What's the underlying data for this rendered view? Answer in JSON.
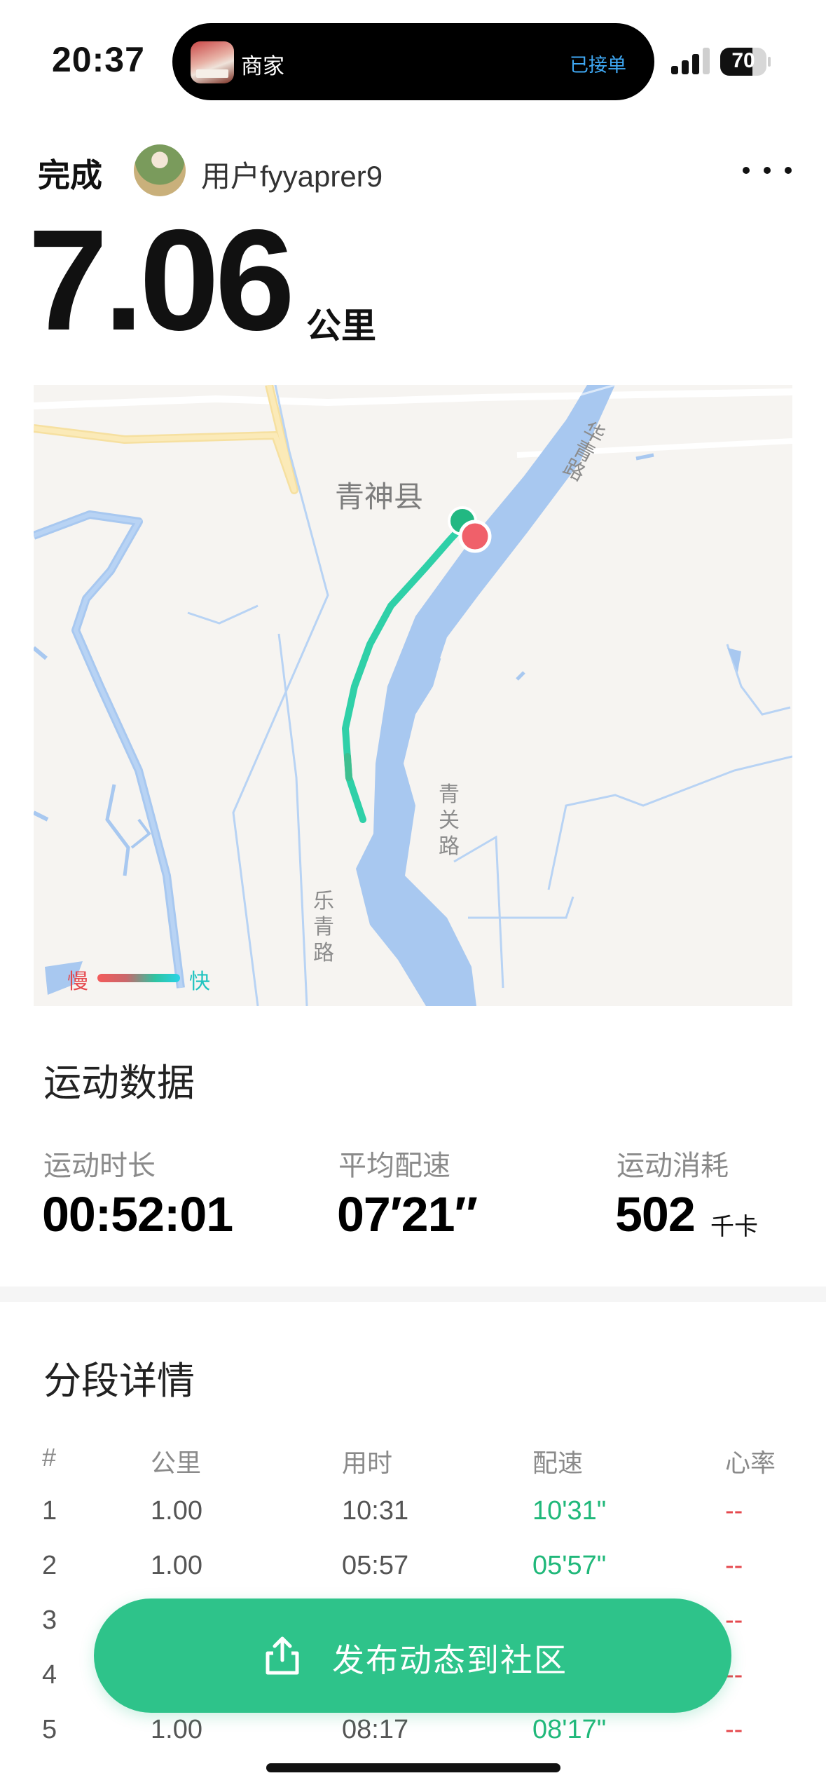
{
  "status_bar": {
    "time": "20:37",
    "island_title": "商家",
    "island_status": "已接单",
    "battery_percent": 70,
    "battery_label": "70"
  },
  "header": {
    "done_label": "完成",
    "username": "用户fyyaprer9",
    "more_icon": "more-dots-icon"
  },
  "summary": {
    "distance": "7.06",
    "distance_unit": "公里"
  },
  "map": {
    "county_label": "青神县",
    "road_labels": {
      "huaqing": "华青路",
      "qingguan": "青关路",
      "leqing": "乐青路"
    },
    "legend": {
      "slow": "慢",
      "fast": "快"
    },
    "colors": {
      "water": "#a8c8f0",
      "route": "#2fd0a8",
      "start": "#22b882",
      "end": "#f0606a"
    }
  },
  "stats": {
    "title": "运动数据",
    "items": [
      {
        "label": "运动时长",
        "value": "00:52:01",
        "unit": ""
      },
      {
        "label": "平均配速",
        "value": "07′21″",
        "unit": ""
      },
      {
        "label": "运动消耗",
        "value": "502",
        "unit": "千卡"
      }
    ]
  },
  "splits": {
    "title": "分段详情",
    "columns": [
      "#",
      "公里",
      "用时",
      "配速",
      "心率"
    ],
    "rows": [
      [
        "1",
        "1.00",
        "10:31",
        "10'31\"",
        "--"
      ],
      [
        "2",
        "1.00",
        "05:57",
        "05'57\"",
        "--"
      ],
      [
        "3",
        "",
        "",
        "",
        "--"
      ],
      [
        "4",
        "",
        "",
        "",
        "--"
      ],
      [
        "5",
        "1.00",
        "08:17",
        "08'17\"",
        "--"
      ]
    ]
  },
  "publish": {
    "label": "发布动态到社区",
    "icon": "share-icon"
  }
}
